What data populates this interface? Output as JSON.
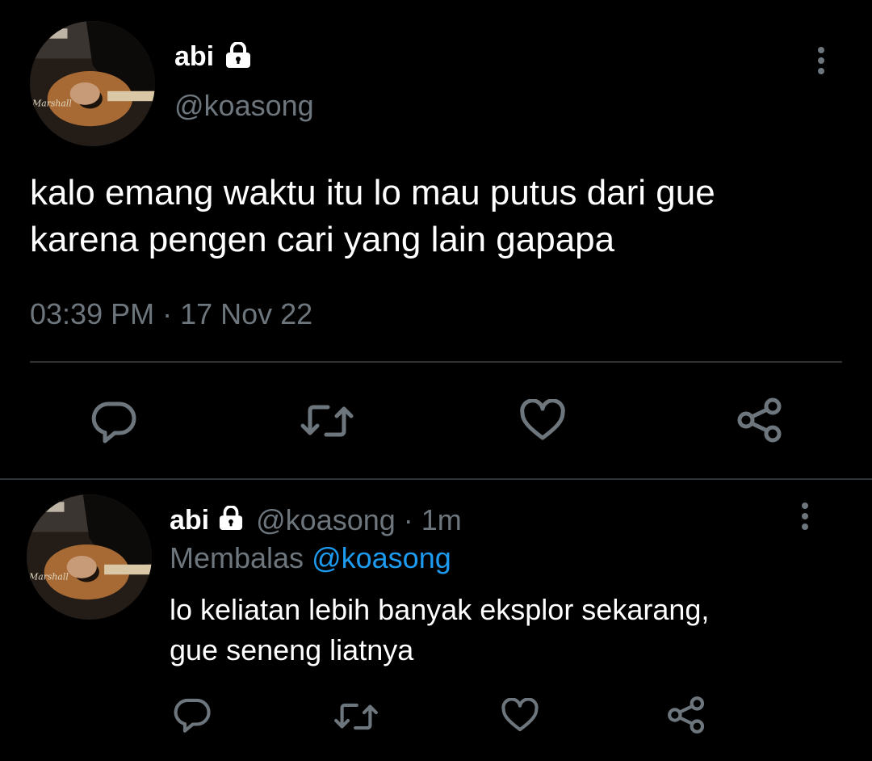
{
  "main_tweet": {
    "display_name": "abi",
    "handle": "@koasong",
    "text_line1": "kalo emang waktu itu lo mau putus dari gue",
    "text_line2": "karena pengen cari yang lain gapapa",
    "timestamp": "03:39 PM · 17 Nov 22"
  },
  "reply": {
    "display_name": "abi",
    "handle": "@koasong",
    "time": "· 1m",
    "replying_label": "Membalas",
    "replying_to": "@koasong",
    "text_line1": "lo keliatan lebih banyak eksplor sekarang,",
    "text_line2": "gue seneng liatnya"
  },
  "icons": {
    "reply": "reply-icon",
    "retweet": "retweet-icon",
    "like": "heart-icon",
    "share": "share-icon",
    "lock": "lock-icon",
    "more": "more-icon"
  },
  "colors": {
    "background": "#000000",
    "muted": "#6e767d",
    "accent": "#1d9bf0",
    "divider": "#2f3336"
  }
}
